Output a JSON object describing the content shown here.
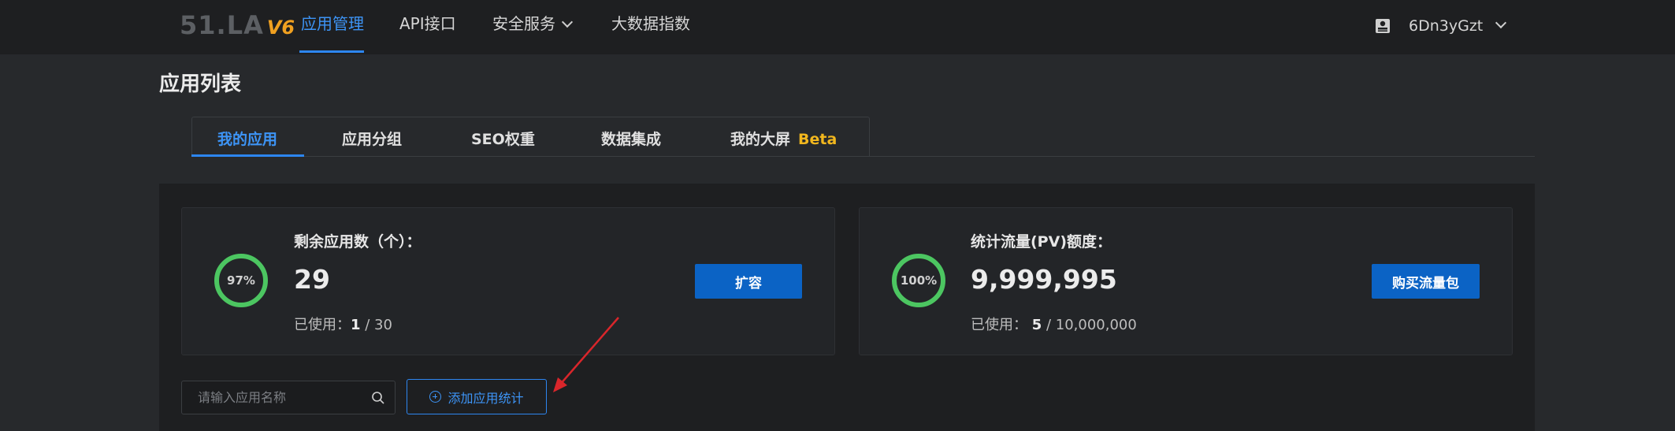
{
  "nav": {
    "logo_text": "51.LA",
    "logo_version": "V6",
    "items": [
      {
        "label": "应用管理",
        "active": true
      },
      {
        "label": "API接口",
        "active": false
      },
      {
        "label": "安全服务",
        "active": false,
        "dropdown": true
      },
      {
        "label": "大数据指数",
        "active": false
      }
    ],
    "user": {
      "name": "6Dn3yGzt",
      "icon": "user-card-icon"
    }
  },
  "page": {
    "title": "应用列表",
    "tabs": [
      {
        "label": "我的应用",
        "active": true
      },
      {
        "label": "应用分组"
      },
      {
        "label": "SEO权重"
      },
      {
        "label": "数据集成"
      },
      {
        "label": "我的大屏",
        "badge": "Beta"
      }
    ]
  },
  "cards": [
    {
      "percent": "97%",
      "label": "剩余应用数（个）：",
      "value": "29",
      "used_prefix": "已使用：",
      "used_value": "1",
      "used_total": " / 30",
      "button": "扩容"
    },
    {
      "percent": "100%",
      "label": "统计流量(PV)额度：",
      "value": "9,999,995",
      "used_prefix": "已使用： ",
      "used_value": "5",
      "used_total": " / 10,000,000",
      "button": "购买流量包"
    }
  ],
  "toolbar": {
    "search_placeholder": "请输入应用名称",
    "add_button": "添加应用统计"
  },
  "colors": {
    "accent": "#2d86f0",
    "ring": "#4cc661",
    "beta": "#f2b71e",
    "annotation_arrow": "#d9262b"
  }
}
